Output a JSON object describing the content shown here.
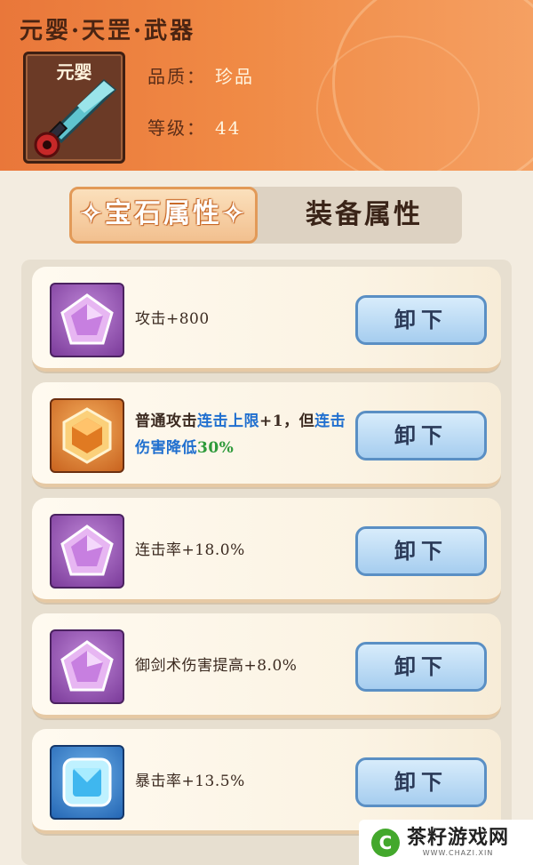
{
  "header": {
    "title": "元婴·天罡·武器",
    "weapon_label": "元婴",
    "quality_label": "品质：",
    "quality_value": "珍品",
    "level_label": "等级：",
    "level_value": "44"
  },
  "tabs": {
    "active": "✧宝石属性✧",
    "inactive": "装备属性"
  },
  "gems": [
    {
      "color": "purple",
      "icon": "pentagon-gem-icon",
      "parts": [
        {
          "t": "攻击+800",
          "c": ""
        }
      ],
      "button": "卸下"
    },
    {
      "color": "orange",
      "icon": "hexagon-gem-icon",
      "parts": [
        {
          "t": "普通攻击",
          "c": "b"
        },
        {
          "t": "连击上限",
          "c": "hl"
        },
        {
          "t": "+1，但",
          "c": "b"
        },
        {
          "t": "连击伤害降低",
          "c": "hl"
        },
        {
          "t": "30%",
          "c": "gr"
        }
      ],
      "button": "卸下"
    },
    {
      "color": "purple",
      "icon": "pentagon-gem-icon",
      "parts": [
        {
          "t": "连击率+18.0%",
          "c": ""
        }
      ],
      "button": "卸下"
    },
    {
      "color": "purple",
      "icon": "pentagon-gem-icon",
      "parts": [
        {
          "t": "御剑术伤害提高+8.0%",
          "c": ""
        }
      ],
      "button": "卸下"
    },
    {
      "color": "blue",
      "icon": "square-gem-icon",
      "parts": [
        {
          "t": "暴击率+13.5%",
          "c": ""
        }
      ],
      "button": "卸下"
    }
  ],
  "watermark": {
    "logo": "C",
    "name": "茶籽游戏网",
    "url": "WWW.CHAZI.XIN"
  },
  "colors": {
    "header_orange": "#f08a45",
    "highlight_blue": "#1f6fcf",
    "highlight_green": "#2e9a3a",
    "button_blue": "#a6cdef"
  }
}
